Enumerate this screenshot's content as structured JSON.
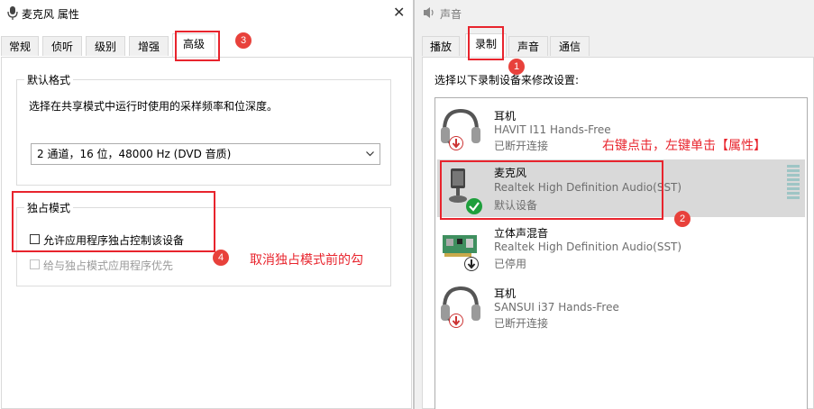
{
  "left": {
    "title": "麦克风 属性",
    "close": "✕",
    "tabs": [
      "常规",
      "侦听",
      "级别",
      "增强",
      "高级"
    ],
    "default_format": {
      "label": "默认格式",
      "desc": "选择在共享模式中运行时使用的采样频率和位深度。",
      "value": "2 通道，16 位，48000 Hz (DVD 音质)"
    },
    "exclusive": {
      "label": "独占模式",
      "allow": "允许应用程序独占控制该设备",
      "priority": "给与独占模式应用程序优先"
    }
  },
  "right": {
    "title": "声音",
    "tabs": [
      "播放",
      "录制",
      "声音",
      "通信"
    ],
    "instruction": "选择以下录制设备来修改设置:",
    "devices": [
      {
        "name": "耳机",
        "desc": "HAVIT I11 Hands-Free",
        "status": "已断开连接"
      },
      {
        "name": "麦克风",
        "desc": "Realtek High Definition Audio(SST)",
        "status": "默认设备"
      },
      {
        "name": "立体声混音",
        "desc": "Realtek High Definition Audio(SST)",
        "status": "已停用"
      },
      {
        "name": "耳机",
        "desc": "SANSUI i37 Hands-Free",
        "status": "已断开连接"
      }
    ]
  },
  "annotations": {
    "badges": [
      "1",
      "2",
      "3",
      "4"
    ],
    "right_click": "右键点击，左键单击【属性】",
    "uncheck": "取消独占模式前的勾"
  },
  "colors": {
    "annotation_red": "#e8242d",
    "badge_red": "#e8413b",
    "check_green": "#1e9f3c"
  }
}
